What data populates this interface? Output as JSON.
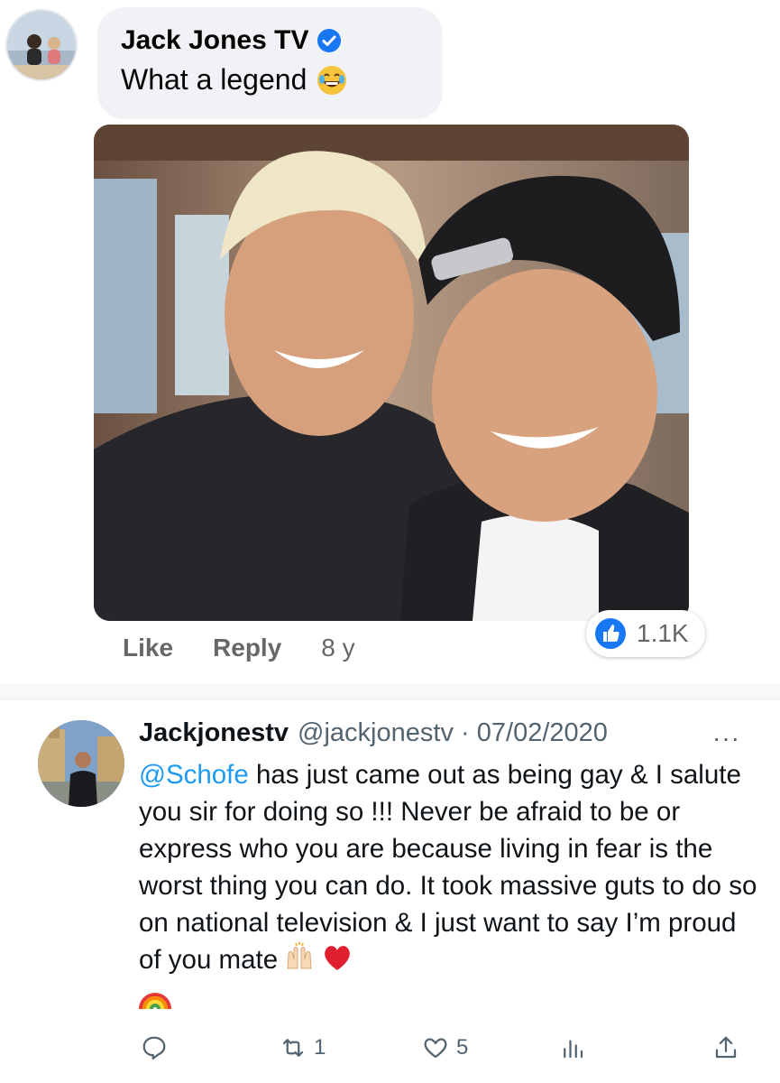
{
  "facebook_comment": {
    "author": "Jack Jones TV",
    "text": "What a legend",
    "actions": {
      "like": "Like",
      "reply": "Reply"
    },
    "time_ago": "8 y",
    "reaction_count": "1.1K",
    "icons": [
      "verified-badge-icon",
      "laughing-emoji-icon",
      "like-thumbs-up-icon"
    ]
  },
  "tweet": {
    "display_name": "Jackjonestv",
    "handle": "@jackjonestv",
    "separator": "·",
    "date": "07/02/2020",
    "more": "···",
    "mention": "@Schofe",
    "body_text": " has just came out as being gay & I salute you sir for doing so !!! Never be afraid to be or express who you are because living in fear is the worst thing you can do. It took massive guts to do so on national television & I just want to say I’m proud of you mate",
    "emojis": [
      "raising-hands-icon",
      "red-heart-icon",
      "rainbow-icon"
    ],
    "actions": {
      "reply_count": "",
      "retweet_count": "1",
      "like_count": "5",
      "views_count": "",
      "share_count": ""
    }
  },
  "colors": {
    "fb_bubble": "#f0f2f5",
    "fb_blue": "#1877f2",
    "fb_grey_text": "#65676b",
    "twitter_link": "#1d9bf0",
    "twitter_grey": "#536471"
  }
}
